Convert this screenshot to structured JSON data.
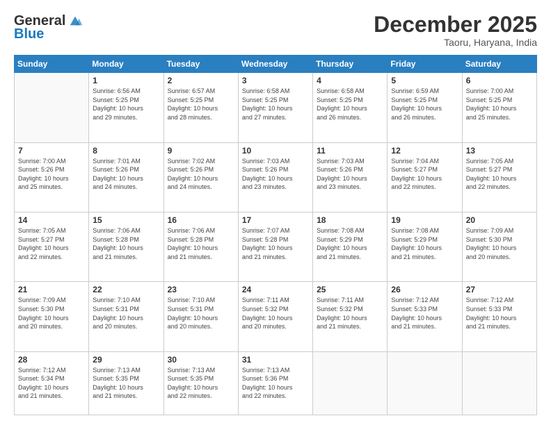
{
  "header": {
    "logo_line1": "General",
    "logo_line2": "Blue",
    "month": "December 2025",
    "location": "Taoru, Haryana, India"
  },
  "weekdays": [
    "Sunday",
    "Monday",
    "Tuesday",
    "Wednesday",
    "Thursday",
    "Friday",
    "Saturday"
  ],
  "weeks": [
    [
      {
        "day": "",
        "info": ""
      },
      {
        "day": "1",
        "info": "Sunrise: 6:56 AM\nSunset: 5:25 PM\nDaylight: 10 hours\nand 29 minutes."
      },
      {
        "day": "2",
        "info": "Sunrise: 6:57 AM\nSunset: 5:25 PM\nDaylight: 10 hours\nand 28 minutes."
      },
      {
        "day": "3",
        "info": "Sunrise: 6:58 AM\nSunset: 5:25 PM\nDaylight: 10 hours\nand 27 minutes."
      },
      {
        "day": "4",
        "info": "Sunrise: 6:58 AM\nSunset: 5:25 PM\nDaylight: 10 hours\nand 26 minutes."
      },
      {
        "day": "5",
        "info": "Sunrise: 6:59 AM\nSunset: 5:25 PM\nDaylight: 10 hours\nand 26 minutes."
      },
      {
        "day": "6",
        "info": "Sunrise: 7:00 AM\nSunset: 5:25 PM\nDaylight: 10 hours\nand 25 minutes."
      }
    ],
    [
      {
        "day": "7",
        "info": "Sunrise: 7:00 AM\nSunset: 5:26 PM\nDaylight: 10 hours\nand 25 minutes."
      },
      {
        "day": "8",
        "info": "Sunrise: 7:01 AM\nSunset: 5:26 PM\nDaylight: 10 hours\nand 24 minutes."
      },
      {
        "day": "9",
        "info": "Sunrise: 7:02 AM\nSunset: 5:26 PM\nDaylight: 10 hours\nand 24 minutes."
      },
      {
        "day": "10",
        "info": "Sunrise: 7:03 AM\nSunset: 5:26 PM\nDaylight: 10 hours\nand 23 minutes."
      },
      {
        "day": "11",
        "info": "Sunrise: 7:03 AM\nSunset: 5:26 PM\nDaylight: 10 hours\nand 23 minutes."
      },
      {
        "day": "12",
        "info": "Sunrise: 7:04 AM\nSunset: 5:27 PM\nDaylight: 10 hours\nand 22 minutes."
      },
      {
        "day": "13",
        "info": "Sunrise: 7:05 AM\nSunset: 5:27 PM\nDaylight: 10 hours\nand 22 minutes."
      }
    ],
    [
      {
        "day": "14",
        "info": "Sunrise: 7:05 AM\nSunset: 5:27 PM\nDaylight: 10 hours\nand 22 minutes."
      },
      {
        "day": "15",
        "info": "Sunrise: 7:06 AM\nSunset: 5:28 PM\nDaylight: 10 hours\nand 21 minutes."
      },
      {
        "day": "16",
        "info": "Sunrise: 7:06 AM\nSunset: 5:28 PM\nDaylight: 10 hours\nand 21 minutes."
      },
      {
        "day": "17",
        "info": "Sunrise: 7:07 AM\nSunset: 5:28 PM\nDaylight: 10 hours\nand 21 minutes."
      },
      {
        "day": "18",
        "info": "Sunrise: 7:08 AM\nSunset: 5:29 PM\nDaylight: 10 hours\nand 21 minutes."
      },
      {
        "day": "19",
        "info": "Sunrise: 7:08 AM\nSunset: 5:29 PM\nDaylight: 10 hours\nand 21 minutes."
      },
      {
        "day": "20",
        "info": "Sunrise: 7:09 AM\nSunset: 5:30 PM\nDaylight: 10 hours\nand 20 minutes."
      }
    ],
    [
      {
        "day": "21",
        "info": "Sunrise: 7:09 AM\nSunset: 5:30 PM\nDaylight: 10 hours\nand 20 minutes."
      },
      {
        "day": "22",
        "info": "Sunrise: 7:10 AM\nSunset: 5:31 PM\nDaylight: 10 hours\nand 20 minutes."
      },
      {
        "day": "23",
        "info": "Sunrise: 7:10 AM\nSunset: 5:31 PM\nDaylight: 10 hours\nand 20 minutes."
      },
      {
        "day": "24",
        "info": "Sunrise: 7:11 AM\nSunset: 5:32 PM\nDaylight: 10 hours\nand 20 minutes."
      },
      {
        "day": "25",
        "info": "Sunrise: 7:11 AM\nSunset: 5:32 PM\nDaylight: 10 hours\nand 21 minutes."
      },
      {
        "day": "26",
        "info": "Sunrise: 7:12 AM\nSunset: 5:33 PM\nDaylight: 10 hours\nand 21 minutes."
      },
      {
        "day": "27",
        "info": "Sunrise: 7:12 AM\nSunset: 5:33 PM\nDaylight: 10 hours\nand 21 minutes."
      }
    ],
    [
      {
        "day": "28",
        "info": "Sunrise: 7:12 AM\nSunset: 5:34 PM\nDaylight: 10 hours\nand 21 minutes."
      },
      {
        "day": "29",
        "info": "Sunrise: 7:13 AM\nSunset: 5:35 PM\nDaylight: 10 hours\nand 21 minutes."
      },
      {
        "day": "30",
        "info": "Sunrise: 7:13 AM\nSunset: 5:35 PM\nDaylight: 10 hours\nand 22 minutes."
      },
      {
        "day": "31",
        "info": "Sunrise: 7:13 AM\nSunset: 5:36 PM\nDaylight: 10 hours\nand 22 minutes."
      },
      {
        "day": "",
        "info": ""
      },
      {
        "day": "",
        "info": ""
      },
      {
        "day": "",
        "info": ""
      }
    ]
  ]
}
